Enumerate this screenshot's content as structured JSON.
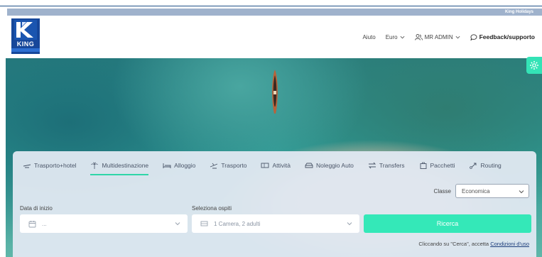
{
  "topbar": {
    "brand_text": "King Holidays"
  },
  "logo": {
    "text": "KING",
    "colors": {
      "primary": "#16479a",
      "accent": "#2d6fd1"
    }
  },
  "nav": {
    "help": "Aiuto",
    "currency": "Euro",
    "user": "MR ADMIN",
    "feedback": "Feedback/supporto",
    "icons": {
      "currency": "chevron-down-icon",
      "user": "users-icon",
      "feedback": "chat-bubble-icon"
    }
  },
  "tabs": [
    {
      "label": "Trasporto+hotel",
      "icon": "transport-hotel-icon"
    },
    {
      "label": "Multidestinazione",
      "icon": "palm-tree-icon",
      "active": true
    },
    {
      "label": "Alloggio",
      "icon": "bed-icon"
    },
    {
      "label": "Trasporto",
      "icon": "plane-icon"
    },
    {
      "label": "Attività",
      "icon": "ticket-icon"
    },
    {
      "label": "Noleggio Auto",
      "icon": "car-icon"
    },
    {
      "label": "Transfers",
      "icon": "transfer-arrows-icon"
    },
    {
      "label": "Pacchetti",
      "icon": "package-icon"
    },
    {
      "label": "Routing",
      "icon": "route-icon"
    }
  ],
  "search": {
    "class_label": "Classe",
    "class_value": "Economica",
    "start_date_label": "Data di inizio",
    "start_date_value": "...",
    "guests_label": "Seleziona ospiti",
    "guests_value": "1 Camera, 2 adulti",
    "search_button": "Ricerca",
    "terms_prefix": "Cliccando su \"Cerca\", accetta ",
    "terms_link": "Condizioni d'uso"
  },
  "colors": {
    "accent": "#34e8b8",
    "panel": "#dfe7f0",
    "brand": "#16479a"
  }
}
